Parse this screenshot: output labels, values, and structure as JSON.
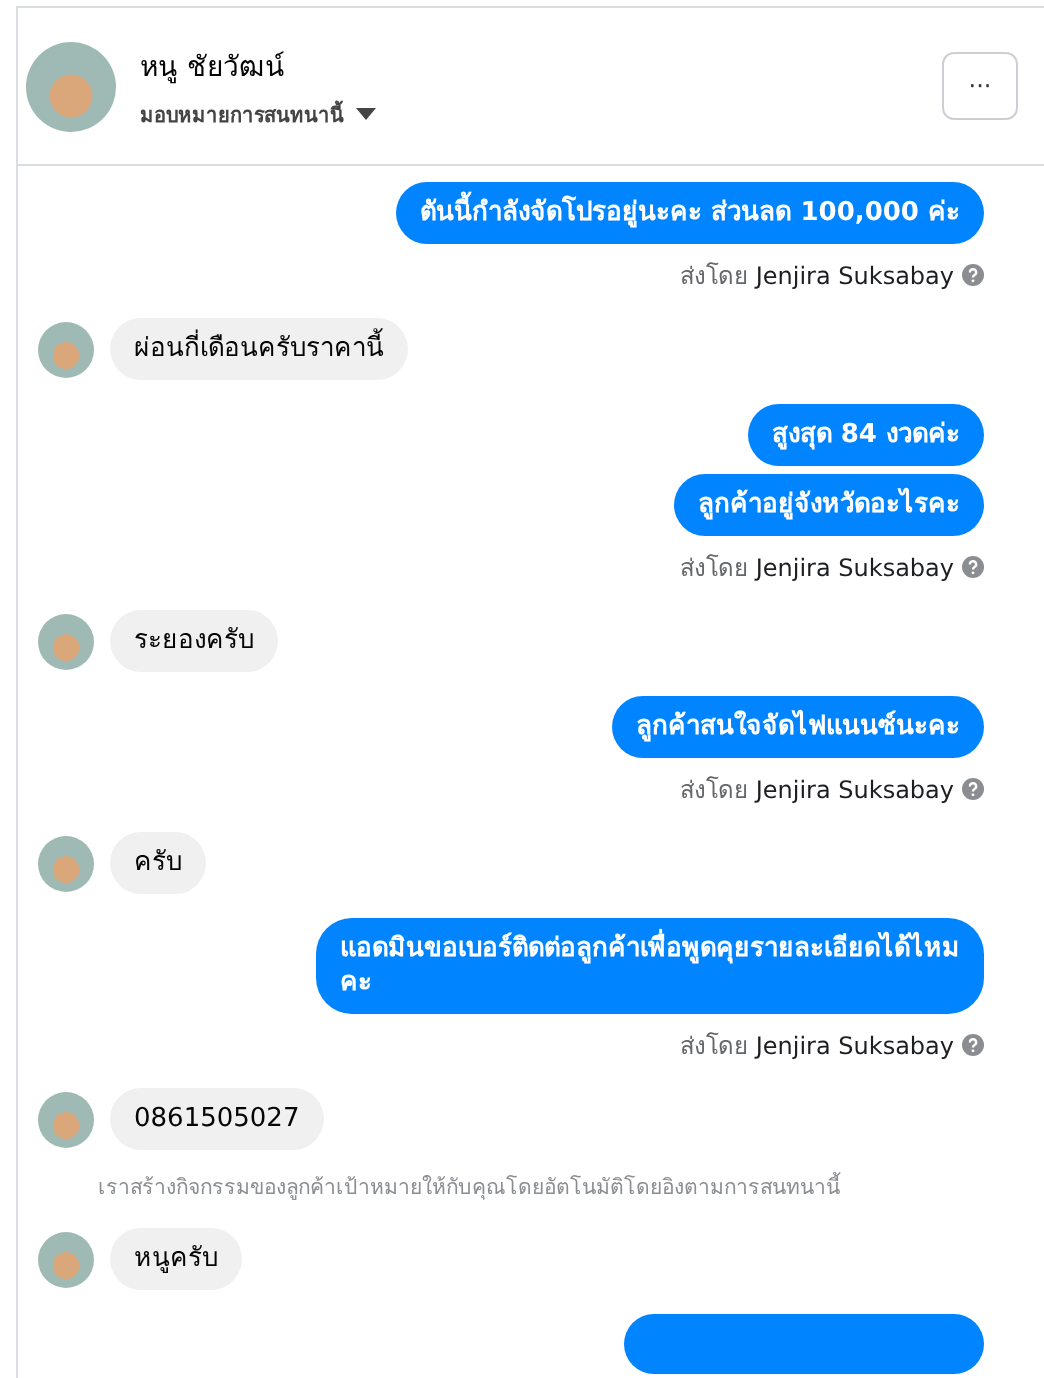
{
  "header": {
    "name": "หนู ชัยวัฒน์",
    "subtitle": "มอบหมายการสนทนานี้",
    "more_button": "···"
  },
  "messages": [
    {
      "kind": "outgoing",
      "text": "ตันนี้กำลังจัดโปรอยู่นะคะ ส่วนลด 100,000 ค่ะ",
      "sent_by_label": "ส่งโดย",
      "sent_by_name": "Jenjira Suksabay"
    },
    {
      "kind": "incoming",
      "text": "ผ่อนกี่เดือนครับราคานี้"
    },
    {
      "kind": "outgoing",
      "text": "สูงสุด 84 งวดค่ะ"
    },
    {
      "kind": "outgoing",
      "text": "ลูกค้าอยู่จังหวัดอะไรคะ",
      "sent_by_label": "ส่งโดย",
      "sent_by_name": "Jenjira Suksabay"
    },
    {
      "kind": "incoming",
      "text": "ระยองครับ"
    },
    {
      "kind": "outgoing",
      "text": "ลูกค้าสนใจจัดไฟแนนซ์นะคะ",
      "sent_by_label": "ส่งโดย",
      "sent_by_name": "Jenjira Suksabay"
    },
    {
      "kind": "incoming",
      "text": "ครับ"
    },
    {
      "kind": "outgoing",
      "text": "แอดมินขอเบอร์ติดต่อลูกค้าเพื่อพูดคุยรายละเอียดได้ไหมคะ",
      "sent_by_label": "ส่งโดย",
      "sent_by_name": "Jenjira Suksabay"
    },
    {
      "kind": "incoming",
      "text": "0861505027"
    },
    {
      "kind": "system",
      "text": "เราสร้างกิจกรรมของลูกค้าเป้าหมายให้กับคุณโดยอัตโนมัติโดยอิงตามการสนทนานี้"
    },
    {
      "kind": "incoming",
      "text": "หนูครับ"
    },
    {
      "kind": "partial"
    }
  ]
}
